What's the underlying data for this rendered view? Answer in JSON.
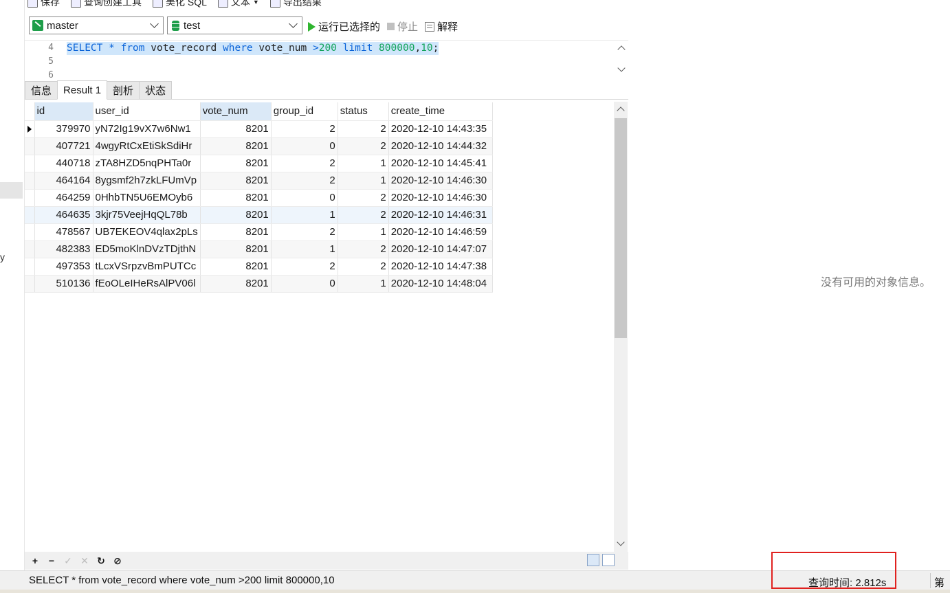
{
  "toolbar": {
    "save": "保存",
    "query_builder": "查询创建工具",
    "beautify_sql": "美化 SQL",
    "text": "文本",
    "export_results": "导出结果"
  },
  "connection": {
    "database": "master",
    "schema": "test"
  },
  "actions": {
    "run_selected": "运行已选择的",
    "stop": "停止",
    "explain": "解释"
  },
  "editor": {
    "lines": [
      "4",
      "5",
      "6"
    ],
    "tokens": {
      "select": "SELECT",
      "star": "*",
      "from": "from",
      "table": "vote_record",
      "where": "where",
      "column": "vote_num",
      "gt": ">",
      "value": "200",
      "limit": "limit",
      "offset": "800000",
      "comma": ",",
      "count": "10",
      "semicolon": ";"
    }
  },
  "tabs": [
    "信息",
    "Result 1",
    "剖析",
    "状态"
  ],
  "grid": {
    "columns": [
      "id",
      "user_id",
      "vote_num",
      "group_id",
      "status",
      "create_time"
    ],
    "rows": [
      [
        "379970",
        "yN72Ig19vX7w6Nw1",
        "8201",
        "2",
        "2",
        "2020-12-10 14:43:35"
      ],
      [
        "407721",
        "4wgyRtCxEtiSkSdiHr",
        "8201",
        "0",
        "2",
        "2020-12-10 14:44:32"
      ],
      [
        "440718",
        "zTA8HZD5nqPHTa0r",
        "8201",
        "2",
        "1",
        "2020-12-10 14:45:41"
      ],
      [
        "464164",
        "8ygsmf2h7zkLFUmVp",
        "8201",
        "2",
        "1",
        "2020-12-10 14:46:30"
      ],
      [
        "464259",
        "0HhbTN5U6EMOyb6",
        "8201",
        "0",
        "2",
        "2020-12-10 14:46:30"
      ],
      [
        "464635",
        "3kjr75VeejHqQL78b",
        "8201",
        "1",
        "2",
        "2020-12-10 14:46:31"
      ],
      [
        "478567",
        "UB7EKEOV4qlax2pLs",
        "8201",
        "2",
        "1",
        "2020-12-10 14:46:59"
      ],
      [
        "482383",
        "ED5moKlnDVzTDjthN",
        "8201",
        "1",
        "2",
        "2020-12-10 14:47:07"
      ],
      [
        "497353",
        "tLcxVSrpzvBmPUTCc",
        "8201",
        "2",
        "2",
        "2020-12-10 14:47:38"
      ],
      [
        "510136",
        "fEoOLeIHeRsAlPV06l",
        "8201",
        "0",
        "1",
        "2020-12-10 14:48:04"
      ]
    ]
  },
  "grid_controls": {
    "add": "+",
    "delete": "−",
    "apply": "✓",
    "discard": "✕",
    "refresh": "↻",
    "stop": "⊘"
  },
  "right_panel": {
    "empty_message": "没有可用的对象信息。"
  },
  "left_strip": {
    "char": "y"
  },
  "status": {
    "sql": "SELECT * from vote_record where vote_num >200 limit 800000,10",
    "query_time": "查询时间: 2.812s",
    "page": "第"
  },
  "colors": {
    "keyword": "#0a63d8",
    "number": "#12a35a",
    "selection": "#cfe6fb",
    "highlight_box": "#e0211f"
  }
}
